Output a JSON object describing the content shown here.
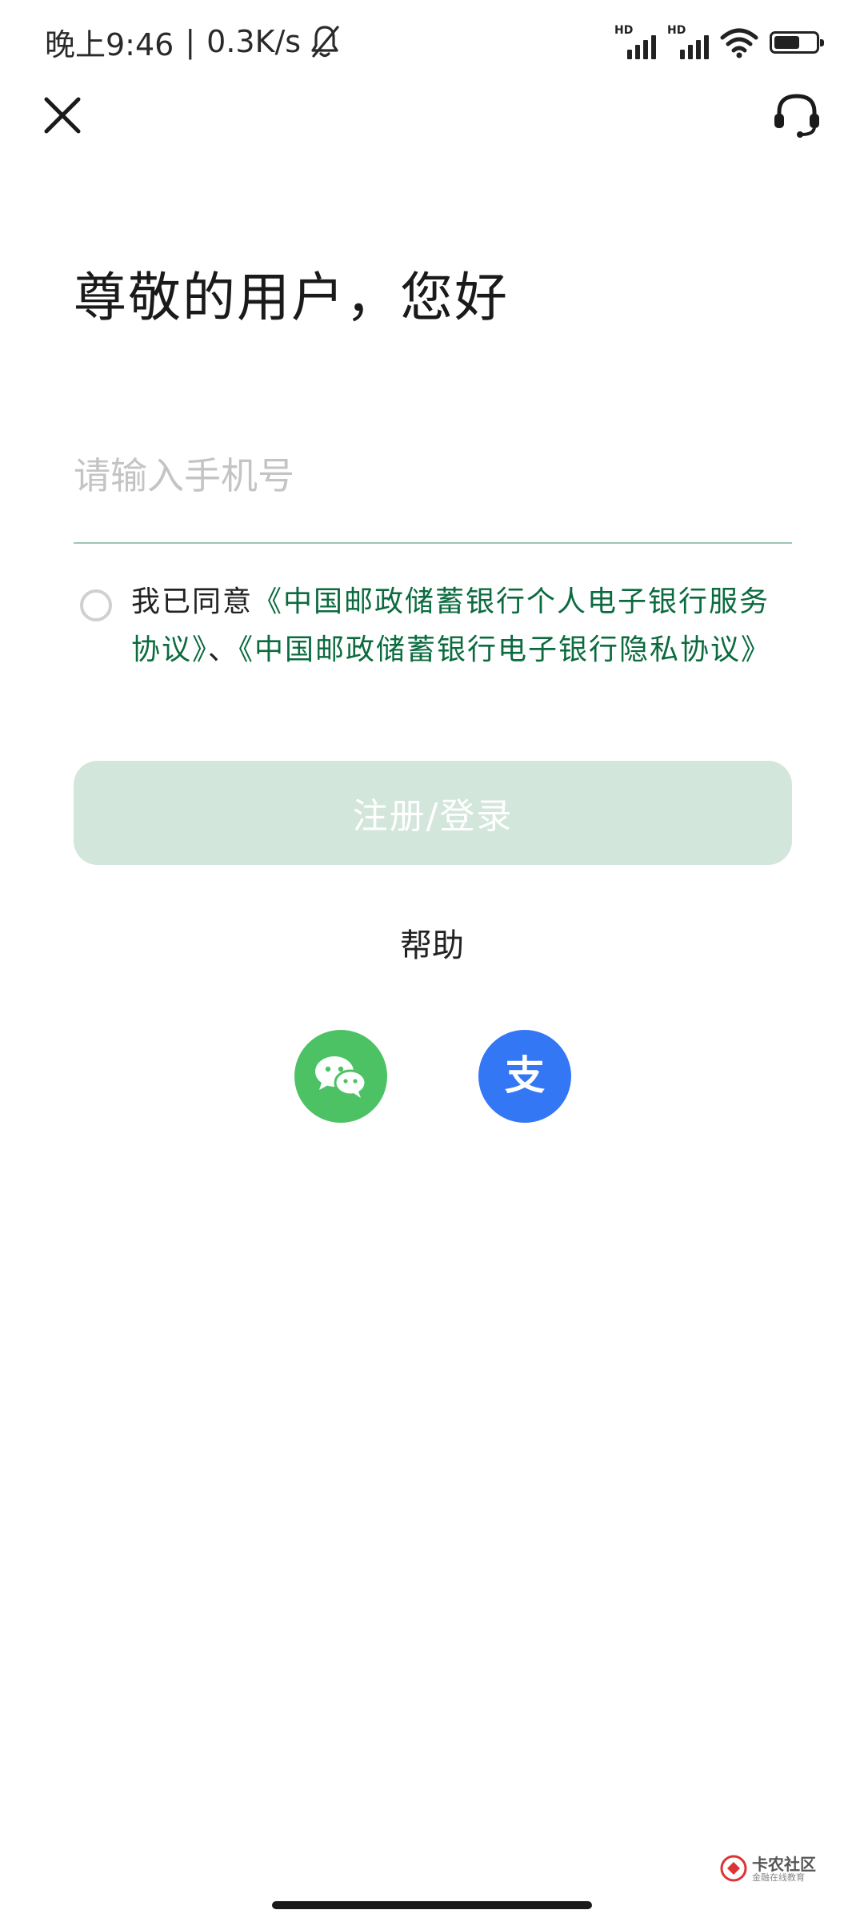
{
  "status_bar": {
    "time": "晚上9:46",
    "separator": "|",
    "speed": "0.3K/s",
    "signal_1_label": "HD",
    "signal_2_label": "HD",
    "battery_level": 0.62
  },
  "nav": {
    "close_icon": "close-icon",
    "service_icon": "headset-icon"
  },
  "title": "尊敬的用户，您好",
  "phone_input": {
    "value": "",
    "placeholder": "请输入手机号"
  },
  "agreement": {
    "prefix": "我已同意",
    "link_1": "《中国邮政储蓄银行个人电子银行服务协议》",
    "joiner": "、",
    "link_2": "《中国邮政储蓄银行电子银行隐私协议》",
    "checked": false
  },
  "login_button": "注册/登录",
  "help_link": "帮助",
  "third_party": {
    "wechat_icon": "wechat-icon",
    "alipay_icon": "alipay-icon",
    "alipay_glyph": "支"
  },
  "watermark": {
    "title": "卡农社区",
    "subtitle": "金融在线教育"
  },
  "colors": {
    "accent_green": "#0b6b3f",
    "button_disabled": "#d2e6dc",
    "input_line": "#9cc8b2",
    "wechat": "#4cc265",
    "alipay": "#3377f5"
  }
}
